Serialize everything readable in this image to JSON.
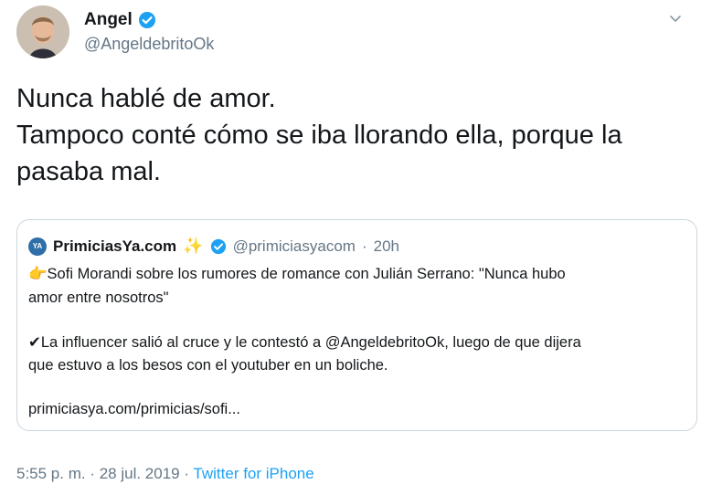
{
  "author": {
    "name": "Angel",
    "handle": "@AngeldebritoOk"
  },
  "tweet": {
    "lines": [
      "Nunca hablé de amor.",
      "Tampoco conté cómo se iba llorando ella, porque la",
      "pasaba mal."
    ]
  },
  "quote": {
    "avatar_text": "YA",
    "name": "PrimiciasYa.com",
    "sparkle": "✨",
    "handle": "@primiciasyacom",
    "separator": "·",
    "time": "20h",
    "emoji1": "👉",
    "line1": "Sofi Morandi sobre los rumores de romance con Julián Serrano: \"Nunca hubo",
    "line2": "amor entre nosotros\"",
    "check": "✔",
    "line3": "La influencer salió al cruce y le contestó a @AngeldebritoOk, luego de que dijera",
    "line4": "que estuvo a los besos con el youtuber en un boliche.",
    "link": "primiciasya.com/primicias/sofi..."
  },
  "footer": {
    "time": "5:55 p. m. · 28 jul. 2019 · ",
    "source": "Twitter for iPhone"
  },
  "colors": {
    "verified": "#1da1f2",
    "secondary_text": "#657786",
    "link": "#1da1f2"
  },
  "icons": {
    "verified": "verified-badge-icon",
    "caret": "chevron-down-icon"
  }
}
